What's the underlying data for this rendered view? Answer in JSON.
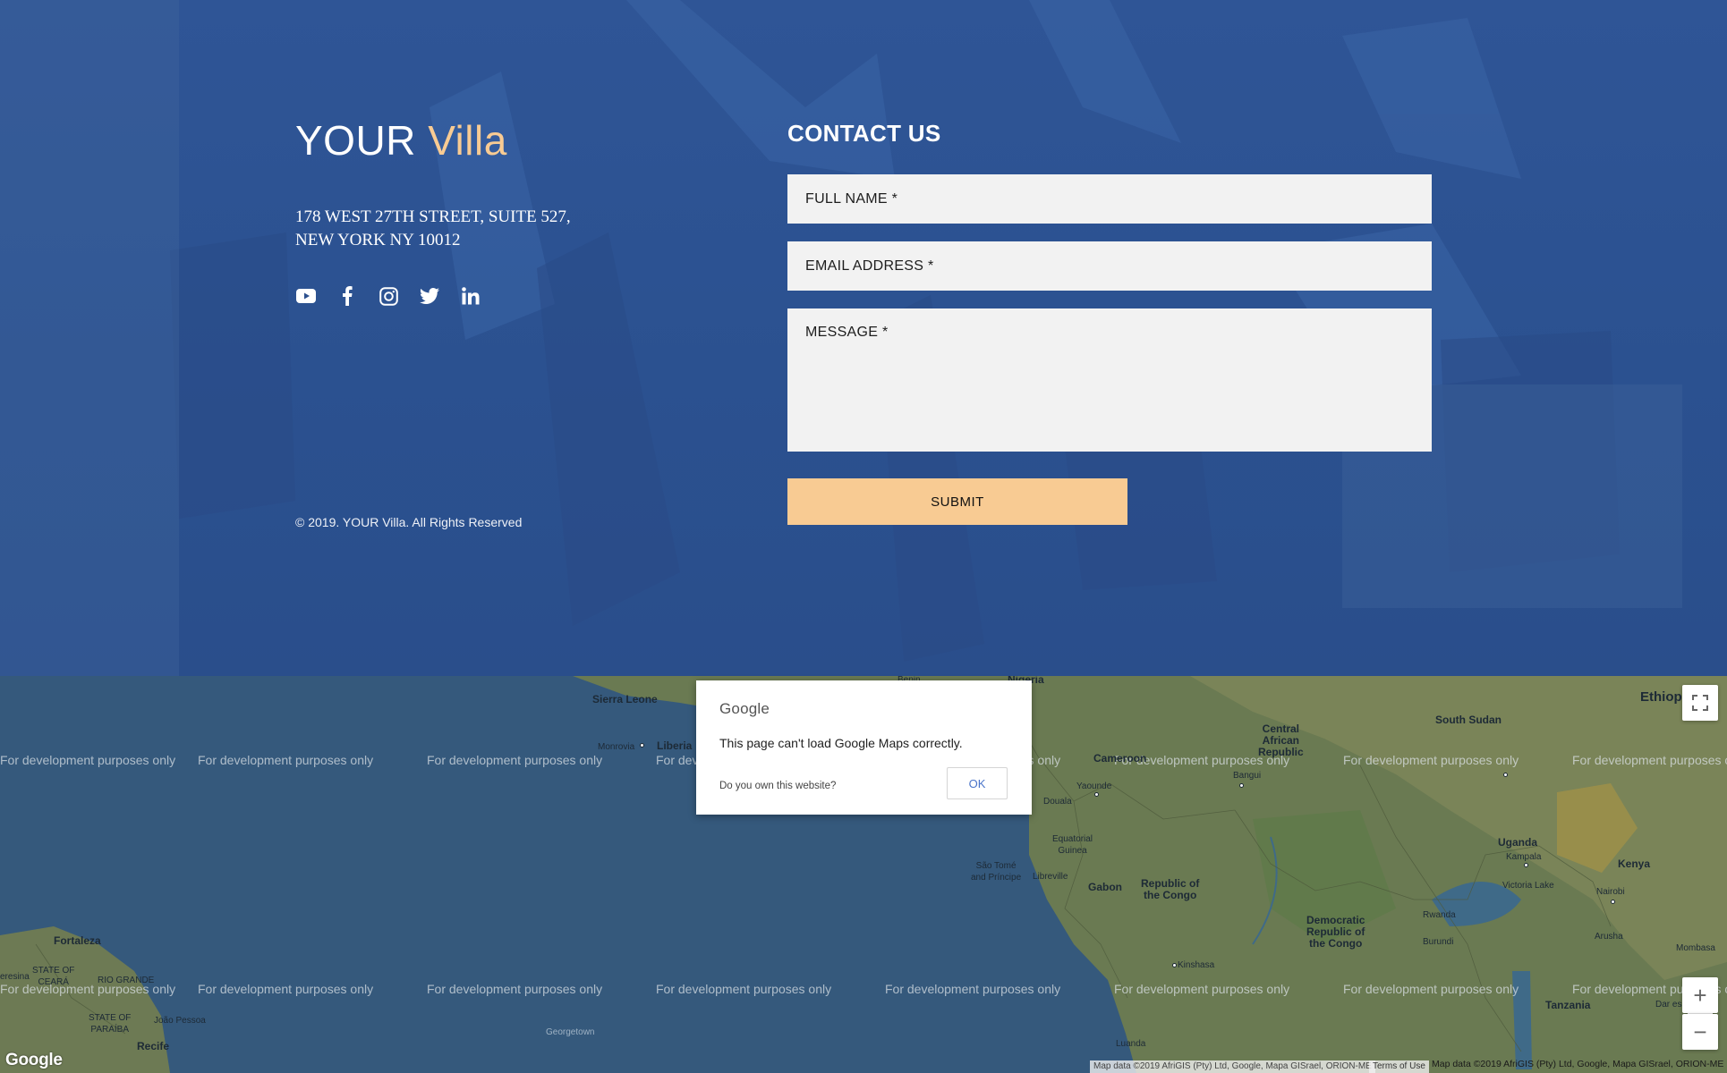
{
  "brand": {
    "name_part1": "YOUR",
    "name_part2": "Villa"
  },
  "address": {
    "line1": "178 WEST 27TH STREET, SUITE 527,",
    "line2": "NEW YORK NY 10012"
  },
  "socials": [
    {
      "icon": "youtube-icon"
    },
    {
      "icon": "facebook-icon"
    },
    {
      "icon": "instagram-icon"
    },
    {
      "icon": "twitter-icon"
    },
    {
      "icon": "linkedin-icon"
    }
  ],
  "copyright": "© 2019. YOUR Villa. All Rights Reserved",
  "contact": {
    "title": "CONTACT US",
    "full_name_placeholder": "FULL NAME *",
    "email_placeholder": "EMAIL ADDRESS *",
    "message_placeholder": "MESSAGE *",
    "submit_label": "SUBMIT"
  },
  "colors": {
    "background_blue": "#2c508e",
    "accent_gold": "#f8cb93",
    "field_bg": "#f2f2f2"
  },
  "map": {
    "watermark_text": "For development purposes only",
    "dialog": {
      "brand": "Google",
      "message": "This page can't load Google Maps correctly.",
      "own_question": "Do you own this website?",
      "ok_label": "OK"
    },
    "labels": {
      "sierra_leone": "Sierra Leone",
      "liberia": "Liberia",
      "monrovia": "Monrovia",
      "nigeria": "Nigeria",
      "benin": "Benin",
      "cameroon": "Cameroon",
      "yaounde": "Yaounde",
      "douala": "Douala",
      "equatorial_guinea_1": "Equatorial",
      "equatorial_guinea_2": "Guinea",
      "sao_tome_1": "São Tomé",
      "sao_tome_2": "and Príncipe",
      "libreville": "Libreville",
      "gabon": "Gabon",
      "republic_congo_1": "Republic of",
      "republic_congo_2": "the Congo",
      "car_1": "Central",
      "car_2": "African",
      "car_3": "Republic",
      "bangui": "Bangui",
      "south_sudan": "South Sudan",
      "ethiopia": "Ethiop",
      "uganda": "Uganda",
      "kampala": "Kampala",
      "kenya": "Kenya",
      "nairobi": "Nairobi",
      "rwanda": "Rwanda",
      "burundi": "Burundi",
      "drc_1": "Democratic",
      "drc_2": "Republic of",
      "drc_3": "the Congo",
      "kinshasa": "Kinshasa",
      "arusha": "Arusha",
      "mombasa": "Mombasa",
      "tanzania": "Tanzania",
      "dar_es_salaam": "Dar es Salaa",
      "luanda": "Luanda",
      "fortaleza": "Fortaleza",
      "ceara_1": "STATE OF",
      "ceara_2": "CEARÁ",
      "rgn": "RIO GRANDE",
      "paraiba_1": "STATE OF",
      "paraiba_2": "PARAÍBA",
      "joao_pessoa": "João Pessoa",
      "recife": "Recife",
      "teresina": "eresina",
      "georgetown": "Georgetown",
      "victoria_lake": "Victoria Lake"
    },
    "google_mark": "Google",
    "attribution_1": "Map data ©2019 AfriGIS (Pty) Ltd, Google, Mapa GISrael, ORION-ME",
    "terms_label": "Terms of Use",
    "attribution_2": "Map data ©2019 AfriGIS (Pty) Ltd, Google, Mapa GISrael, ORION-ME",
    "controls": {
      "zoom_in": "+",
      "zoom_out": "−"
    }
  }
}
